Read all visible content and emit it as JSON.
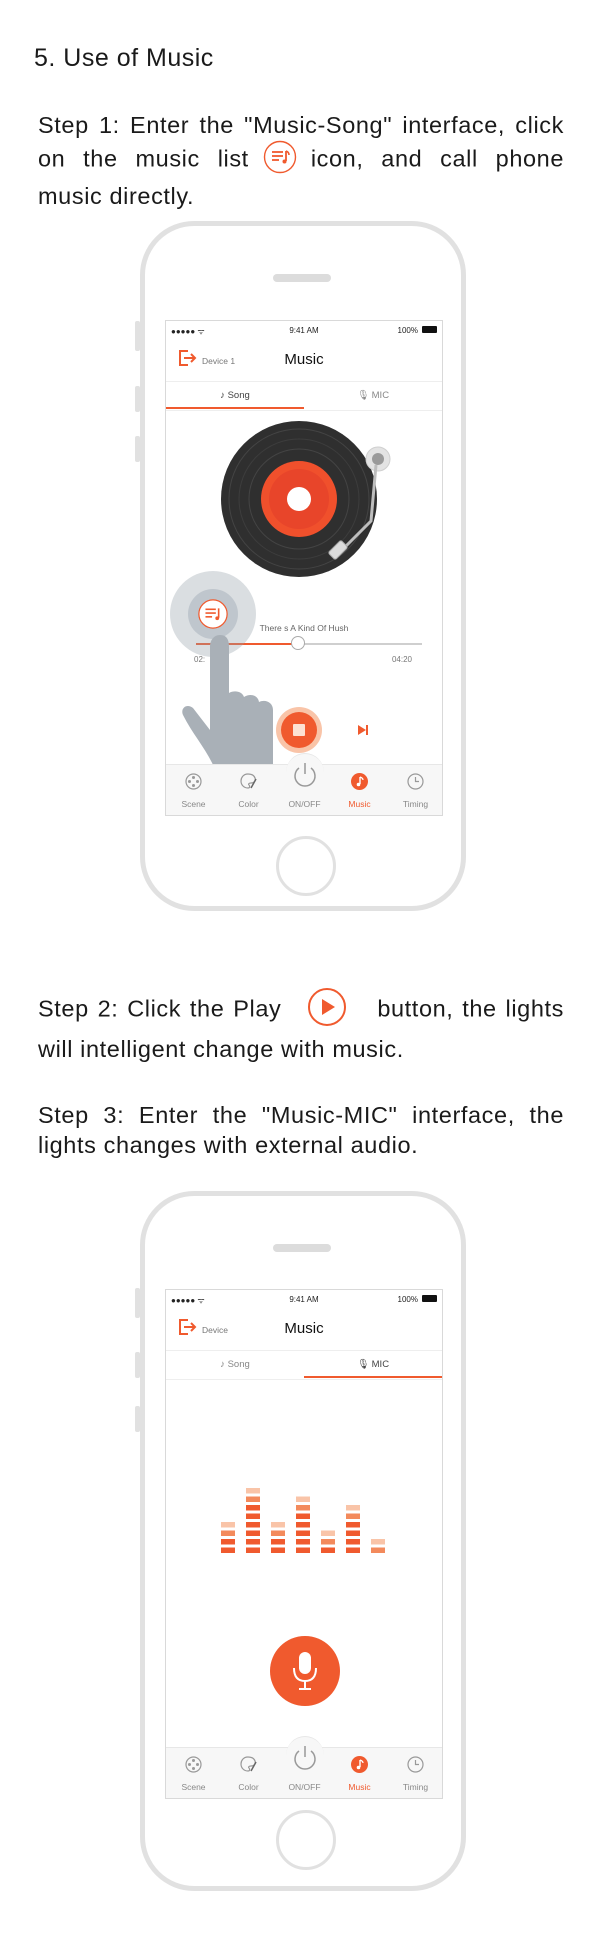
{
  "heading": "5. Use of Music",
  "step1": {
    "before": "Step 1: Enter the \"Music-Song\" interface, click on the music list",
    "after": "icon, and call phone music directly."
  },
  "step2": {
    "before": "Step 2: Click the Play",
    "after": "button, the lights will intelligent change with music."
  },
  "step3": "Step 3: Enter the \"Music-MIC\" interface, the lights changes with external audio.",
  "status": {
    "time": "9:41 AM",
    "battery": "100%",
    "signal": "●●●●● ᯤ"
  },
  "phone1": {
    "device": "Device 1",
    "title": "Music",
    "tab_song": "Song",
    "tab_mic": "MIC",
    "song_name": "There s A Kind Of Hush",
    "time_elapsed": "02:",
    "time_total": "04:20",
    "progress": 0.45
  },
  "phone2": {
    "device": "Device",
    "title": "Music",
    "tab_song": "Song",
    "tab_mic": "MIC"
  },
  "tabbar": [
    "Scene",
    "Color",
    "ON/OFF",
    "Music",
    "Timing"
  ],
  "colors": {
    "accent": "#f05a2e",
    "accent_light": "#f9c4a8"
  },
  "equalizer": [
    4,
    8,
    4,
    7,
    3,
    6,
    2
  ]
}
